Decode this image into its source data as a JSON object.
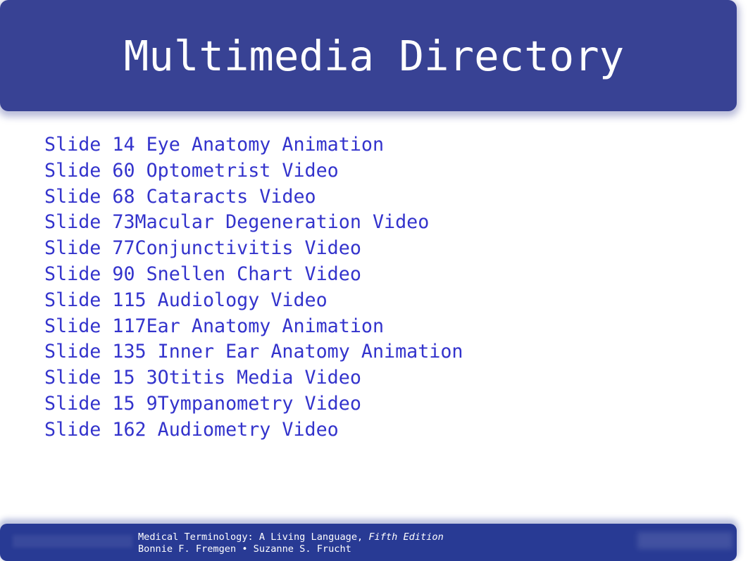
{
  "header": {
    "title": "Multimedia Directory",
    "color": "#384294"
  },
  "items": [
    "Slide 14 Eye Anatomy Animation",
    "Slide 60 Optometrist Video",
    "Slide 68 Cataracts Video",
    "Slide 73Macular Degeneration Video",
    "Slide 77Conjunctivitis Video",
    "Slide 90 Snellen Chart Video",
    "Slide 115 Audiology Video",
    "Slide 117Ear Anatomy Animation",
    "Slide 135 Inner Ear Anatomy Animation",
    "Slide 15 3Otitis Media Video",
    "Slide 15 9Tympanometry Video",
    "Slide 162 Audiometry Video"
  ],
  "footer": {
    "book_title": "Medical Terminology: A Living Language, ",
    "edition": "Fifth Edition",
    "authors": "Bonnie F. Fremgen • Suzanne S. Frucht",
    "color": "#283a94"
  },
  "link_color": "#3333cc"
}
